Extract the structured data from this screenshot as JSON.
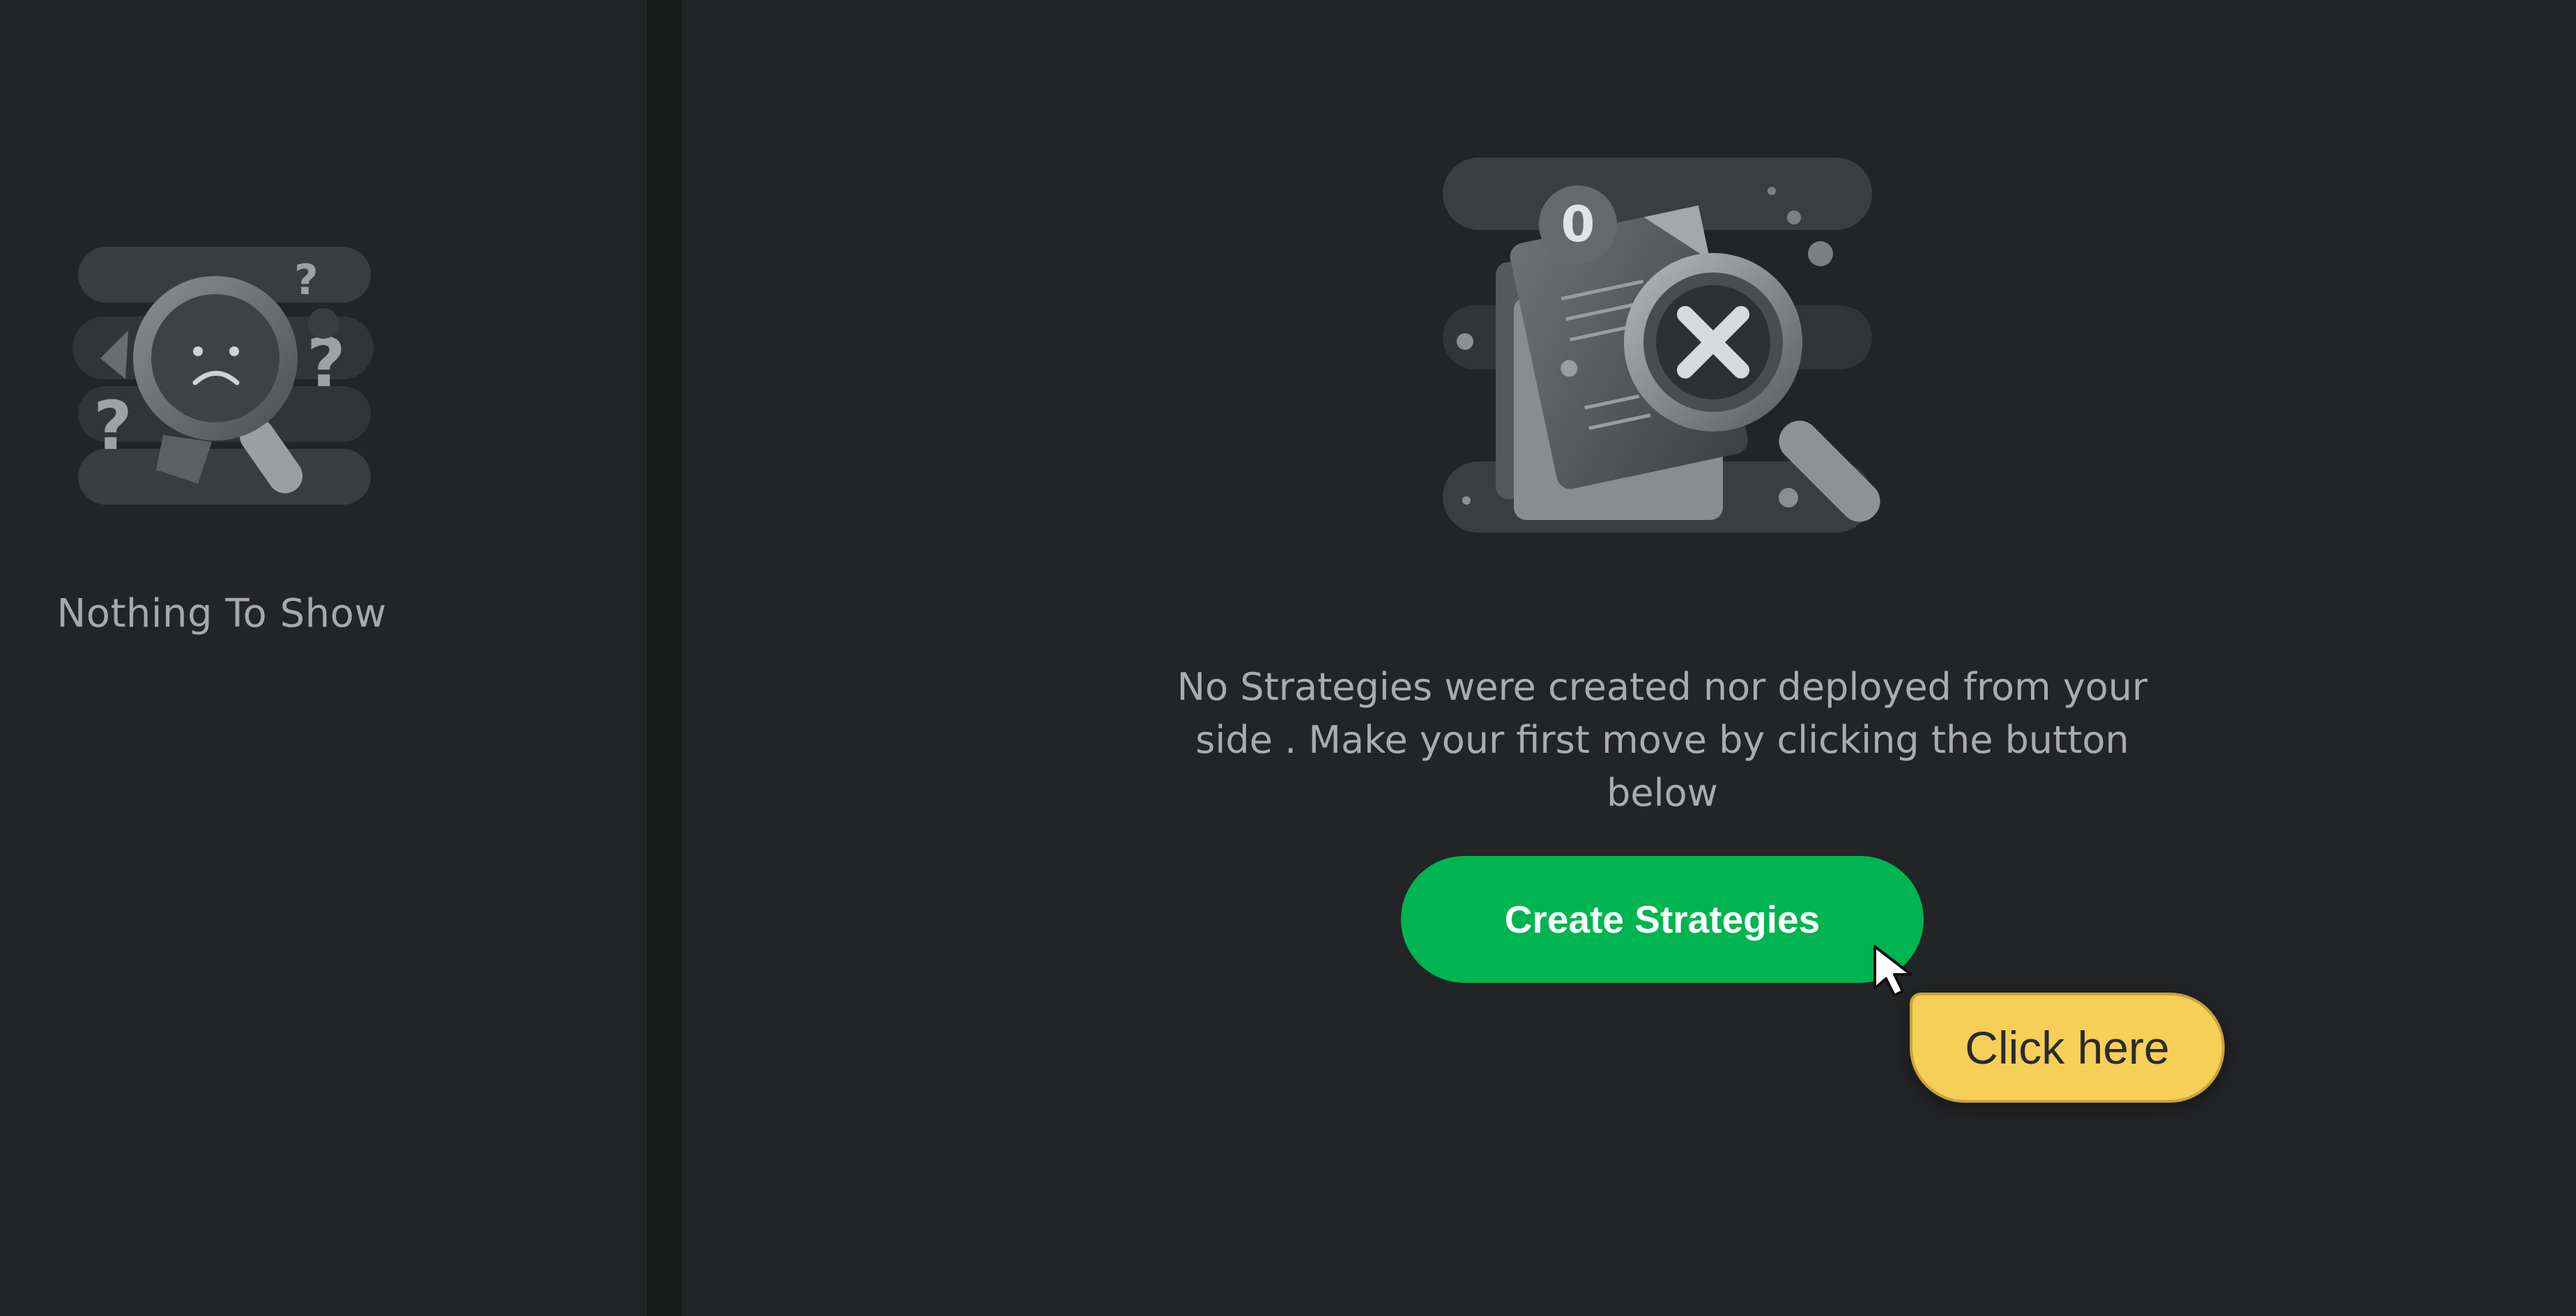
{
  "left_panel": {
    "empty_state_text": "Nothing To Show"
  },
  "main": {
    "empty_state_message": "No Strategies were created nor deployed from your side . Make your first move by clicking the button below",
    "create_button_label": "Create Strategies",
    "illustration_badge": "0"
  },
  "tooltip": {
    "text": "Click here"
  },
  "colors": {
    "background": "#232426",
    "divider": "#181919",
    "accent_green": "#00b451",
    "tooltip_yellow": "#f5cf58",
    "muted_text": "#a9abad"
  },
  "icons": {
    "left_illustration": "sad-magnifier-icon",
    "main_illustration": "empty-document-magnifier-icon",
    "cursor": "cursor-arrow-icon"
  }
}
